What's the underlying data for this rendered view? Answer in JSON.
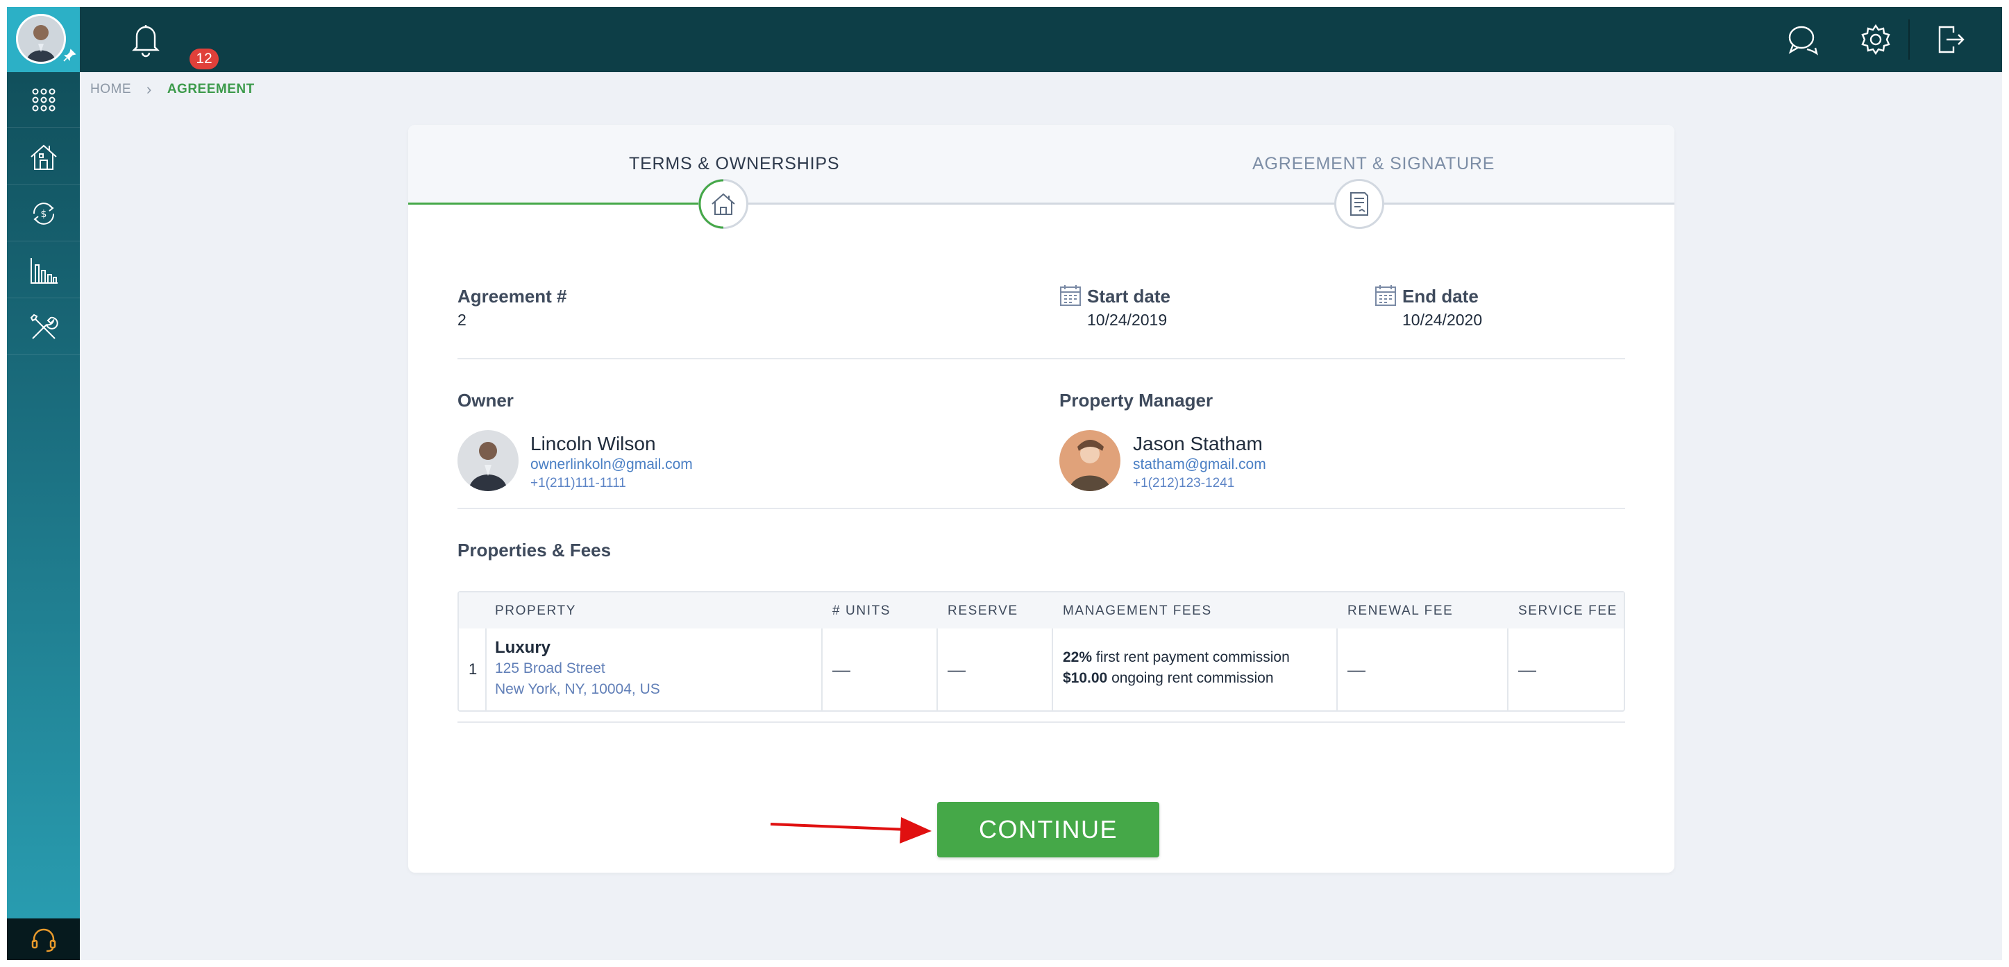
{
  "topbar": {
    "notification_count": "12",
    "icons": [
      "bell-icon",
      "chat-icon",
      "gear-icon",
      "logout-icon"
    ]
  },
  "sidebar": {
    "items": [
      {
        "name": "apps",
        "icon": "grid-icon"
      },
      {
        "name": "properties",
        "icon": "house-icon"
      },
      {
        "name": "finance",
        "icon": "money-cycle-icon"
      },
      {
        "name": "reports",
        "icon": "bar-chart-icon"
      },
      {
        "name": "tools",
        "icon": "tools-icon"
      }
    ],
    "bottom_icon": "headset-icon"
  },
  "breadcrumb": {
    "home": "HOME",
    "current": "AGREEMENT"
  },
  "steps": [
    {
      "label": "TERMS & OWNERSHIPS",
      "active": true,
      "icon": "house-icon"
    },
    {
      "label": "AGREEMENT & SIGNATURE",
      "active": false,
      "icon": "document-icon"
    }
  ],
  "agreement": {
    "number_label": "Agreement #",
    "number": "2",
    "start_label": "Start date",
    "start_date": "10/24/2019",
    "end_label": "End date",
    "end_date": "10/24/2020"
  },
  "owner": {
    "section": "Owner",
    "name": "Lincoln Wilson",
    "email": "ownerlinkoln@gmail.com",
    "phone": "+1(211)111-1111"
  },
  "manager": {
    "section": "Property Manager",
    "name": "Jason Statham",
    "email": "statham@gmail.com",
    "phone": "+1(212)123-1241"
  },
  "properties": {
    "section": "Properties & Fees",
    "columns": [
      "PROPERTY",
      "# UNITS",
      "RESERVE",
      "MANAGEMENT FEES",
      "RENEWAL FEE",
      "SERVICE FEE"
    ],
    "rows": [
      {
        "index": "1",
        "name": "Luxury",
        "address1": "125 Broad Street",
        "address2": "New York, NY, 10004, US",
        "units": "—",
        "reserve": "—",
        "fee1_value": "22%",
        "fee1_text": " first rent payment commission",
        "fee2_value": "$10.00",
        "fee2_text": " ongoing rent commission",
        "renewal": "—",
        "service": "—"
      }
    ]
  },
  "actions": {
    "continue_label": "CONTINUE"
  },
  "colors": {
    "accent_green": "#45a848",
    "topbar": "#0d3e47",
    "sidebar_top": "#2cb0c6"
  }
}
